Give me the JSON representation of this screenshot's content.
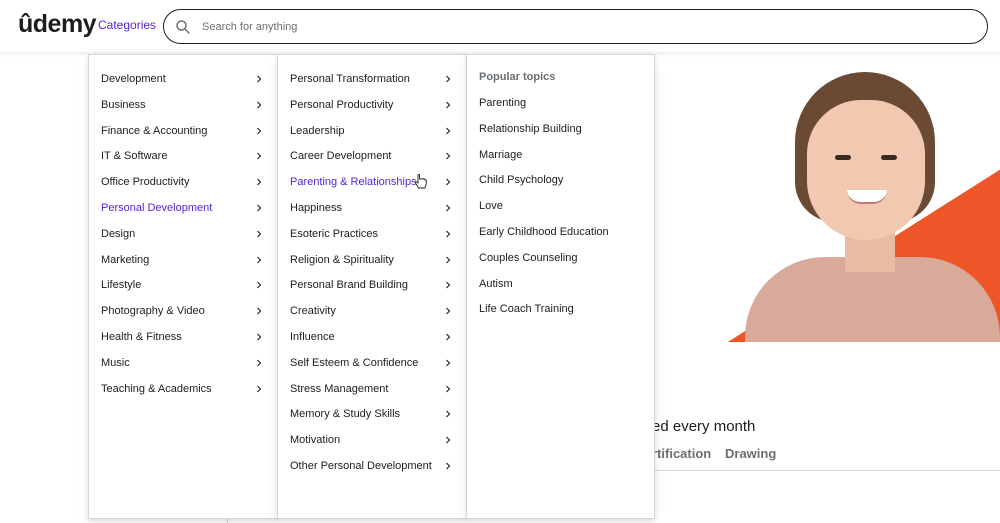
{
  "header": {
    "logo": "ûdemy",
    "categories_label": "Categories",
    "search_placeholder": "Search for anything"
  },
  "hero": {
    "tagline_fragment": "ed every month",
    "tab_cert": "rtification",
    "tab_drawing": "Drawing"
  },
  "menu": {
    "categories": [
      "Development",
      "Business",
      "Finance & Accounting",
      "IT & Software",
      "Office Productivity",
      "Personal Development",
      "Design",
      "Marketing",
      "Lifestyle",
      "Photography & Video",
      "Health & Fitness",
      "Music",
      "Teaching & Academics"
    ],
    "active_category": "Personal Development",
    "subcategories": [
      "Personal Transformation",
      "Personal Productivity",
      "Leadership",
      "Career Development",
      "Parenting & Relationships",
      "Happiness",
      "Esoteric Practices",
      "Religion & Spirituality",
      "Personal Brand Building",
      "Creativity",
      "Influence",
      "Self Esteem & Confidence",
      "Stress Management",
      "Memory & Study Skills",
      "Motivation",
      "Other Personal Development"
    ],
    "active_subcategory": "Parenting & Relationships",
    "popular_heading": "Popular topics",
    "topics": [
      "Parenting",
      "Relationship Building",
      "Marriage",
      "Child Psychology",
      "Love",
      "Early Childhood Education",
      "Couples Counseling",
      "Autism",
      "Life Coach Training"
    ]
  },
  "colors": {
    "accent": "#5624d0",
    "brand_orange": "#ee5529",
    "text": "#1c1d1f",
    "muted": "#6a6f73"
  }
}
